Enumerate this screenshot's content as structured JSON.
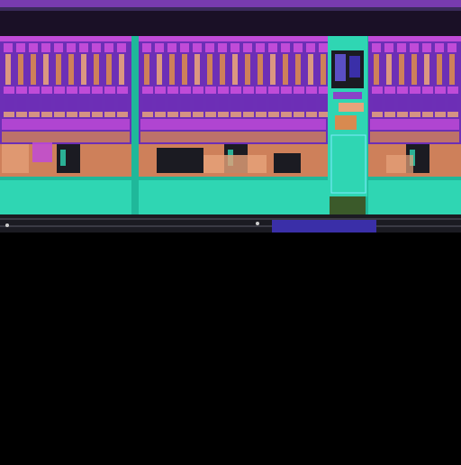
{
  "image": {
    "subject": "die-micrograph-icon",
    "palette": {
      "background": "#000000",
      "top_strip": "#1a1026",
      "top_band_purple": "#8a43c8",
      "magenta": "#c04bd8",
      "violet": "#6d2fb6",
      "orange": "#d88a50",
      "peach": "#e7a37b",
      "teal": "#2fd6b3",
      "teal_dark": "#1fb89a",
      "cyan_highlight": "#7fe9ff",
      "dark": "#1b1b22",
      "metal_line": "#3a3a44",
      "blue_block": "#3a2fa8"
    }
  }
}
